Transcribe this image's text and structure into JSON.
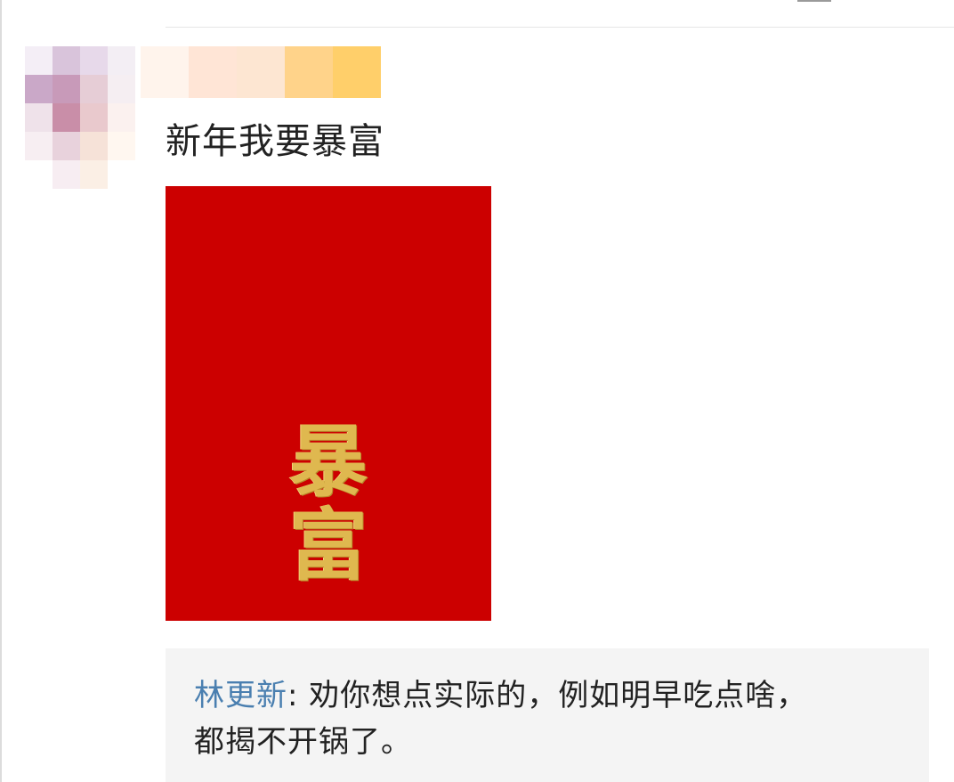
{
  "post": {
    "text": "新年我要暴富"
  },
  "image": {
    "envelope_color": "#cc0000",
    "gold_color": "#dfb84f",
    "chars": [
      "暴",
      "富"
    ]
  },
  "comment": {
    "author": "林更新",
    "separator": ": ",
    "line1": "劝你想点实际的，例如明早吃点啥，",
    "line2": "都揭不开锅了。"
  }
}
